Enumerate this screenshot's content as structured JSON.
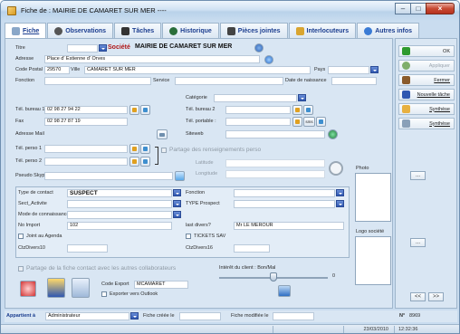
{
  "window": {
    "title": "Fiche de : MAIRIE DE CAMARET SUR MER ----"
  },
  "tabs": [
    {
      "label": "Fiche",
      "icon": "card-icon"
    },
    {
      "label": "Observations",
      "icon": "eye-icon"
    },
    {
      "label": "Tâches",
      "icon": "pen-icon"
    },
    {
      "label": "Historique",
      "icon": "clock-icon"
    },
    {
      "label": "Pièces jointes",
      "icon": "attach-icon"
    },
    {
      "label": "Interlocuteurs",
      "icon": "people-icon"
    },
    {
      "label": "Autres infos",
      "icon": "info-icon"
    }
  ],
  "form": {
    "titre_label": "Titre",
    "societe_label": "Société",
    "societe_value": "MAIRIE DE CAMARET SUR MER",
    "adresse_label": "Adresse",
    "adresse_value": "Place d' Estienne d' Orves",
    "code_postal_label": "Code Postal",
    "code_postal_value": "29570",
    "ville_label": "Ville",
    "ville_value": "CAMARET SUR MER",
    "pays_label": "Pays",
    "fonction_label": "Fonction",
    "service_label": "Service",
    "date_naissance_label": "Date de naissance",
    "categorie_label": "Catégorie",
    "tel_bureau1_label": "Tél. bureau 1",
    "tel_bureau1_value": "02 98 27 94 22",
    "tel_bureau2_label": "Tél. bureau 2",
    "fax_label": "Fax",
    "fax_value": "02 98 27 87 19",
    "tel_portable_label": "Tél. portable :",
    "adresse_mail_label": "Adresse Mail",
    "siteweb_label": "Siteweb",
    "tel_perso1_label": "Tél. perso 1",
    "tel_perso2_label": "Tél. perso 2",
    "partage_renseignements": "Partage des renseignements perso",
    "latitude_label": "Latitude",
    "longitude_label": "Longitude",
    "pseudo_skype_label": "Pseudo Skype",
    "sms_label": "sms",
    "photo_label": "Photo",
    "logo_label": "Logo société"
  },
  "details": {
    "type_contact_label": "Type de contact",
    "type_contact_value": "SUSPECT",
    "sect_activite_label": "Sect_Activite",
    "mode_connaissance_label": "Mode de connaissance",
    "no_import_label": "No Import",
    "no_import_value": "102",
    "joint_agenda_label": "Joint au Agenda",
    "ctzdivers10_label": "CtzDivers10",
    "fonction_label": "Fonction",
    "type_prospect_label": "TYPE Prospect",
    "last_divers_label": "last divers?",
    "last_divers_value": "Mr LE MEROUR",
    "tickets_sav_label": "TICKETS SAV",
    "ctzdivers16_label": "CtzDivers16"
  },
  "lower": {
    "partage_fiche": "Partage de la fiche contact avec les autres collaborateurs",
    "code_export_label": "Code Export",
    "code_export_value": "MCAMARET",
    "exporter_outlook": "Exporter vers Outlook",
    "interet_label": "Intérêt du client : Bon/Mal",
    "interet_value": "0"
  },
  "right_buttons": [
    {
      "label": "OK",
      "icon": "check-icon",
      "color": "#2e9a2e"
    },
    {
      "label": "Appliquer",
      "icon": "apply-icon",
      "color": "#7fae6a"
    },
    {
      "label": "Fermer",
      "icon": "door-icon",
      "color": "#8a5a2a"
    },
    {
      "label": "Nouvelle tâche",
      "icon": "task-icon",
      "color": "#2f57b1"
    },
    {
      "label": "Synthèse",
      "icon": "pencil-icon",
      "color": "#e7b040"
    },
    {
      "label": "Synthèse",
      "icon": "report-icon",
      "color": "#8aa0b8"
    }
  ],
  "bottom": {
    "appartient_label": "Appartient à",
    "appartient_value": "Administrateur",
    "fiche_creee_label": "Fiche créée le",
    "fiche_modifiee_label": "Fiche modifiée le",
    "numero_label": "N°",
    "numero_value": "8969"
  },
  "status": {
    "date": "23/03/2010",
    "time": "12:32:36"
  },
  "nav": {
    "prev": "<<",
    "next": ">>",
    "more": "..."
  }
}
